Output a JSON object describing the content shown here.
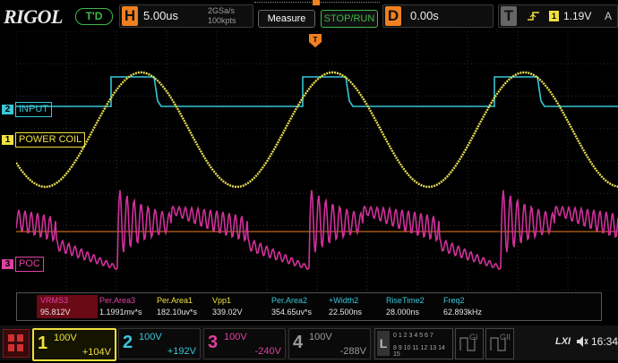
{
  "header": {
    "brand": "RIGOL",
    "run_state": "T'D",
    "horizontal": {
      "key": "H",
      "timebase": "5.00us",
      "sample_rate": "2GSa/s",
      "memory": "100kpts"
    },
    "measure_label": "Measure",
    "stop_run_label": "STOP/RUN",
    "delay": {
      "key": "D",
      "value": "0.00s"
    },
    "trigger": {
      "key": "T",
      "source": "1",
      "level": "1.19V",
      "mode": "A"
    }
  },
  "channel_labels": {
    "ch2": "INPUT",
    "ch1": "POWER COIL",
    "ch3": "POC",
    "ch1_num": "1",
    "ch2_num": "2",
    "ch3_num": "3"
  },
  "measurements": [
    {
      "name": "VRMS3",
      "value": "95.812V",
      "color": "#e040a0",
      "highlight": true
    },
    {
      "name": "Per.Area3",
      "value": "1.1991mv*s",
      "color": "#e040a0",
      "highlight": false
    },
    {
      "name": "Per.Area1",
      "value": "182.10uv*s",
      "color": "#f0e040",
      "highlight": false
    },
    {
      "name": "Vpp1",
      "value": "339.02V",
      "color": "#f0e040",
      "highlight": false
    },
    {
      "name": "Per.Area2",
      "value": "354.65uv*s",
      "color": "#39c6d8",
      "highlight": false
    },
    {
      "name": "+Width2",
      "value": "22.500ns",
      "color": "#39c6d8",
      "highlight": false
    },
    {
      "name": "RiseTime2",
      "value": "28.000ns",
      "color": "#39c6d8",
      "highlight": false
    },
    {
      "name": "Freq2",
      "value": "62.893kHz",
      "color": "#39c6d8",
      "highlight": false
    }
  ],
  "channels": [
    {
      "num": "1",
      "scale": "100V",
      "offset": "+104V",
      "color": "#f0e040",
      "active": true
    },
    {
      "num": "2",
      "scale": "100V",
      "offset": "+192V",
      "color": "#39c6d8",
      "active": false
    },
    {
      "num": "3",
      "scale": "100V",
      "offset": "-240V",
      "color": "#e040a0",
      "active": false
    },
    {
      "num": "4",
      "scale": "100V",
      "offset": "-288V",
      "color": "#9a9a9a",
      "active": false
    }
  ],
  "logic": {
    "key": "L",
    "row1": "0 1 2 3 4 5 6 7",
    "row2": "8 9 10 11 12 13 14 15"
  },
  "gen1_label": "GI",
  "gen2_label": "GII",
  "status": {
    "lxi": "LXI",
    "time": "16:34"
  },
  "colors": {
    "ch1": "#f0e040",
    "ch2": "#39c6d8",
    "ch3": "#e040a0",
    "trigger_level": "#f08020",
    "grid": "#2a2a2a"
  },
  "icons": {
    "menu": "grid-menu-icon",
    "trigger_edge": "rising-edge-icon",
    "speaker": "speaker-muted-icon",
    "trigger_position": "trigger-position-icon"
  }
}
